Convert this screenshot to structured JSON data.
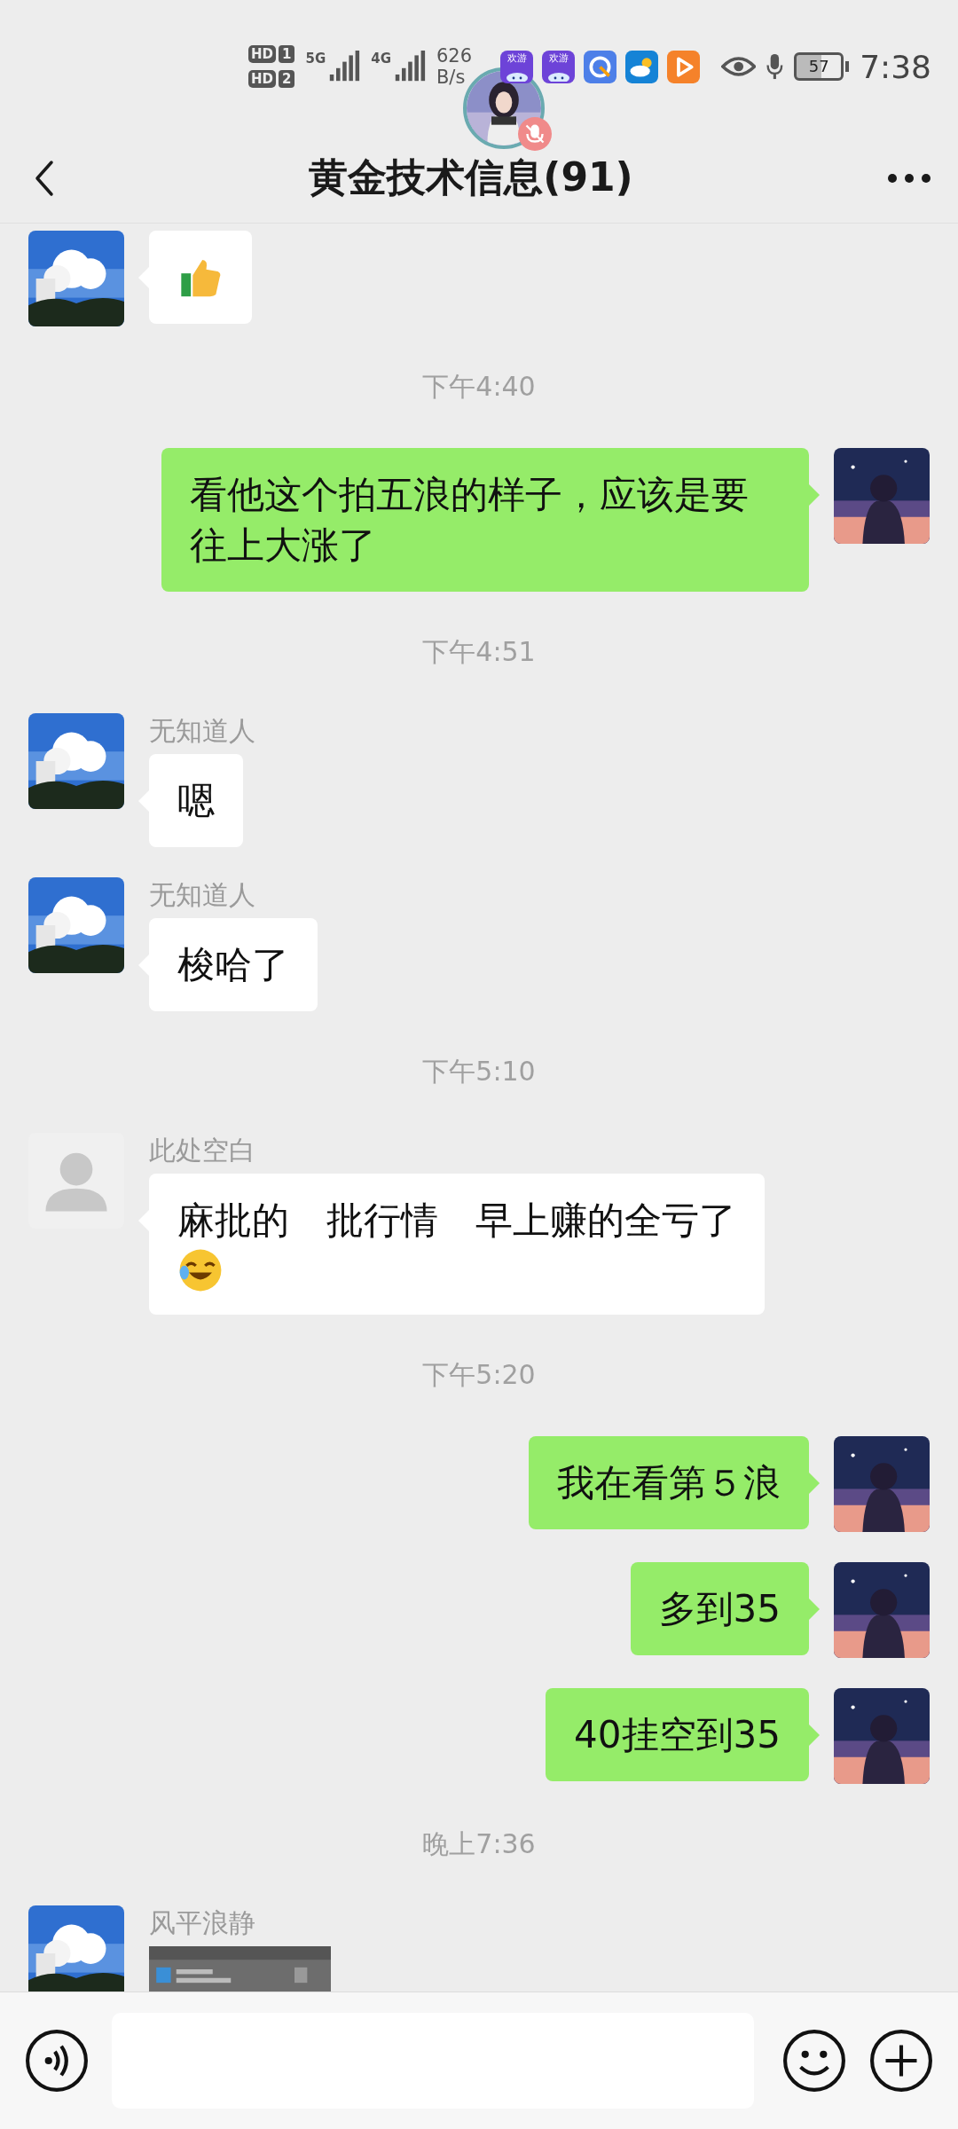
{
  "status_bar": {
    "sims": [
      {
        "label": "HD",
        "slot": "1"
      },
      {
        "label": "HD",
        "slot": "2"
      }
    ],
    "networks": [
      "5G",
      "4G"
    ],
    "speed": [
      "626",
      "B/s"
    ],
    "app_icons": [
      {
        "kind": "game",
        "label": "欢游"
      },
      {
        "kind": "game",
        "label": "欢游"
      },
      {
        "kind": "browser"
      },
      {
        "kind": "weather"
      },
      {
        "kind": "video"
      }
    ],
    "battery": "57",
    "time": "7:38"
  },
  "header": {
    "title": "黄金技术信息(91)"
  },
  "messages": [
    {
      "kind": "emoji",
      "outgoing": false,
      "default_avatar": false
    },
    {
      "kind": "time",
      "text": "下午4:40"
    },
    {
      "kind": "text",
      "outgoing": true,
      "default_avatar": false,
      "text": "看他这个拍五浪的样子，应该是要往上大涨了"
    },
    {
      "kind": "time",
      "text": "下午4:51"
    },
    {
      "kind": "text",
      "outgoing": false,
      "default_avatar": false,
      "name": "无知道人",
      "text": "嗯"
    },
    {
      "kind": "text",
      "outgoing": false,
      "default_avatar": false,
      "name": "无知道人",
      "text": "梭哈了"
    },
    {
      "kind": "time",
      "text": "下午5:10"
    },
    {
      "kind": "text",
      "outgoing": false,
      "default_avatar": true,
      "name": "此处空白",
      "text": "麻批的　批行情　早上赚的全亏了",
      "has_emoji": true
    },
    {
      "kind": "time",
      "text": "下午5:20"
    },
    {
      "kind": "text",
      "outgoing": true,
      "default_avatar": false,
      "text": "我在看第５浪"
    },
    {
      "kind": "text",
      "outgoing": true,
      "default_avatar": false,
      "text": "多到35"
    },
    {
      "kind": "text",
      "outgoing": true,
      "default_avatar": false,
      "text": "40挂空到35"
    },
    {
      "kind": "time",
      "text": "晚上7:36"
    },
    {
      "outgoing": false,
      "default_avatar": false,
      "name": "风平浪静"
    }
  ]
}
